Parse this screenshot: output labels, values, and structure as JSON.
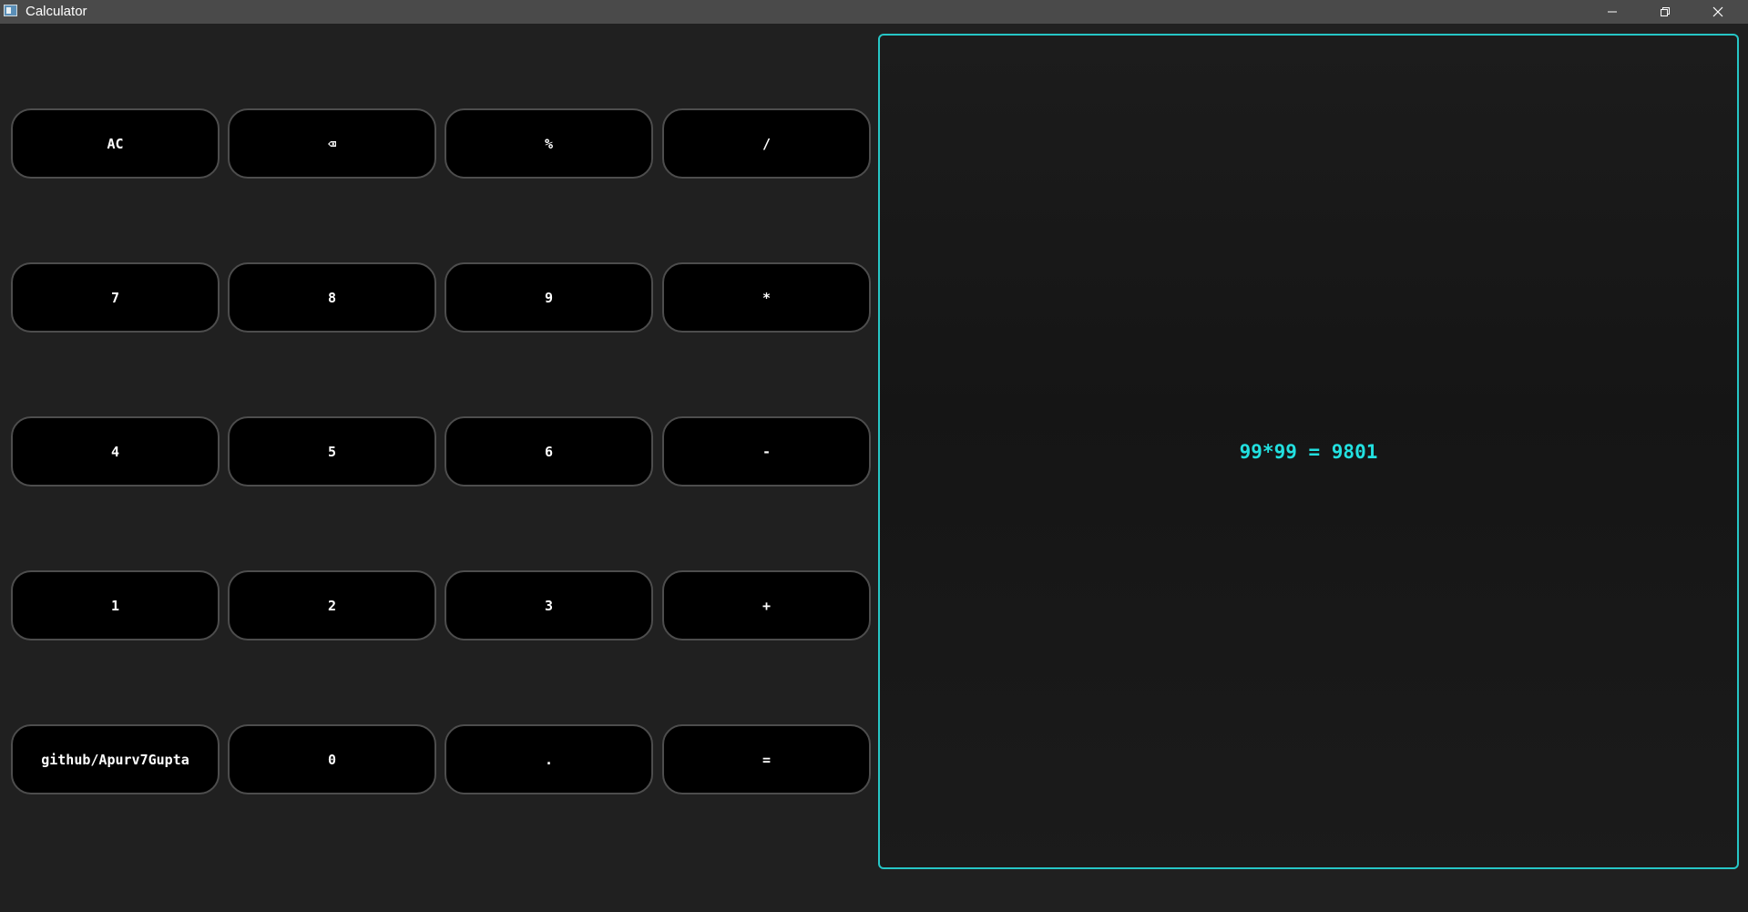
{
  "window": {
    "title": "Calculator",
    "controls": [
      "minimize-icon",
      "restore-icon",
      "close-icon"
    ]
  },
  "keypad": {
    "rows": [
      [
        "AC",
        "⌫",
        "%",
        "/"
      ],
      [
        "7",
        "8",
        "9",
        "*"
      ],
      [
        "4",
        "5",
        "6",
        "-"
      ],
      [
        "1",
        "2",
        "3",
        "+"
      ],
      [
        "github/Apurv7Gupta",
        "0",
        ".",
        "="
      ]
    ]
  },
  "display": {
    "text": "99*99 = 9801"
  },
  "colors": {
    "background": "#202020",
    "titlebar": "#4a4a4a",
    "key_background": "#000000",
    "key_border": "#4d4d4d",
    "accent": "#22e0e0"
  }
}
